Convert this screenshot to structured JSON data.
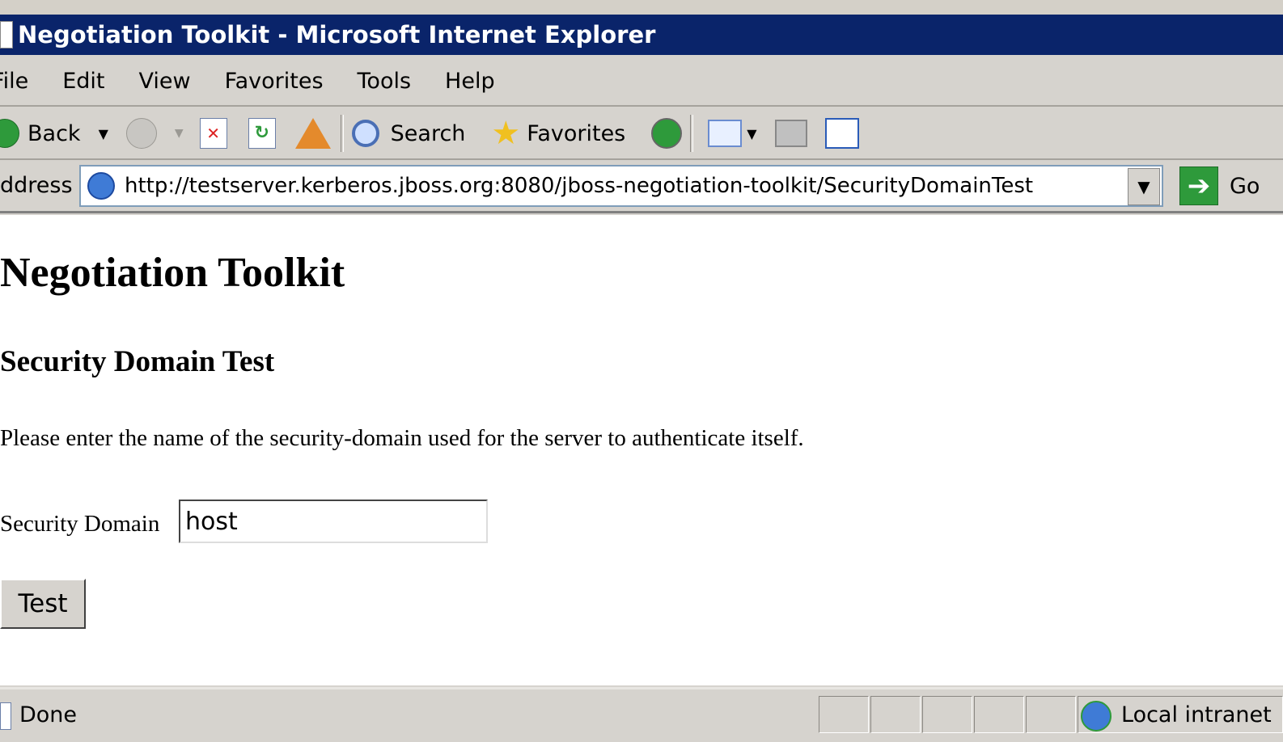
{
  "window": {
    "title": "Negotiation Toolkit - Microsoft Internet Explorer"
  },
  "menu": {
    "items": [
      "File",
      "Edit",
      "View",
      "Favorites",
      "Tools",
      "Help"
    ]
  },
  "toolbar": {
    "back_label": "Back",
    "search_label": "Search",
    "favorites_label": "Favorites"
  },
  "address": {
    "label": "ddress",
    "url": "http://testserver.kerberos.jboss.org:8080/jboss-negotiation-toolkit/SecurityDomainTest",
    "go_label": "Go"
  },
  "page": {
    "heading": "Negotiation Toolkit",
    "subheading": "Security Domain Test",
    "instructions": "Please enter the name of the security-domain used for the server to authenticate itself.",
    "field_label": "Security Domain",
    "field_value": "host",
    "button_label": "Test"
  },
  "status": {
    "text": "Done",
    "zone": "Local intranet"
  },
  "colors": {
    "titlebar": "#0a246a",
    "chrome": "#d6d3ce",
    "accent_green": "#2e9a3b"
  }
}
